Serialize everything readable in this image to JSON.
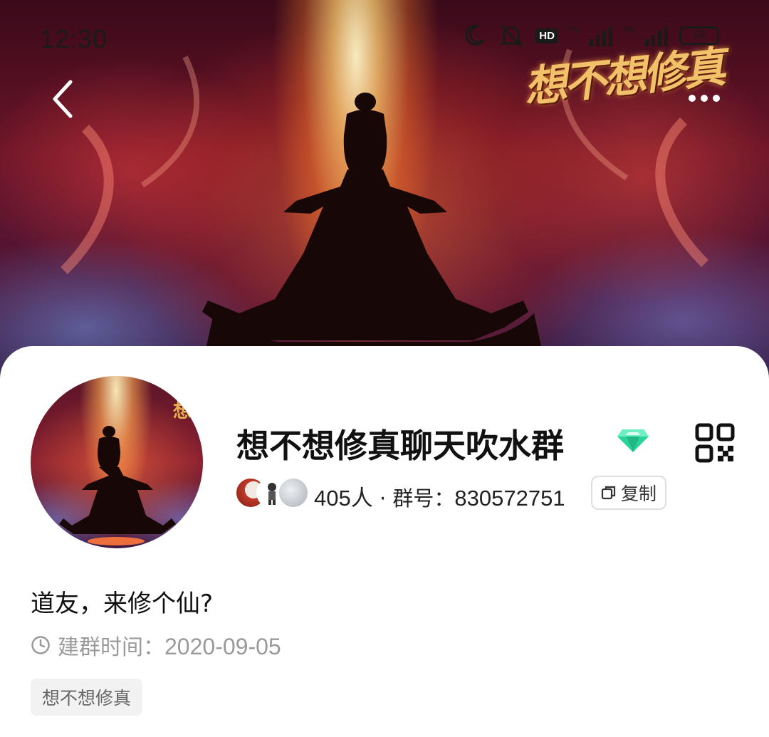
{
  "status_bar": {
    "time": "12:30",
    "hd_label": "HD",
    "net_label_1": "5G",
    "net_label_2": "4G",
    "battery": "58"
  },
  "hero": {
    "logo_text": "想不想修真"
  },
  "group": {
    "name": "想不想修真聊天吹水群",
    "member_count": "405人",
    "separator": " · ",
    "id_label": "群号：",
    "id_value": "830572751",
    "copy_label": "复制",
    "description": "道友，来修个仙?",
    "created_label": "建群时间：",
    "created_date": "2020-09-05",
    "tag": "想不想修真"
  },
  "icons": {
    "back": "chevron-left-icon",
    "more": "more-horizontal-icon",
    "qr": "qr-code-icon",
    "diamond": "diamond-icon",
    "copy": "copy-icon",
    "clock": "clock-icon",
    "moon": "moon-icon",
    "mute": "bell-mute-icon"
  },
  "colors": {
    "diamond": "#2bd39a",
    "text_primary": "#111111",
    "text_muted": "#9a9a9a",
    "tag_bg": "#f2f2f2"
  }
}
